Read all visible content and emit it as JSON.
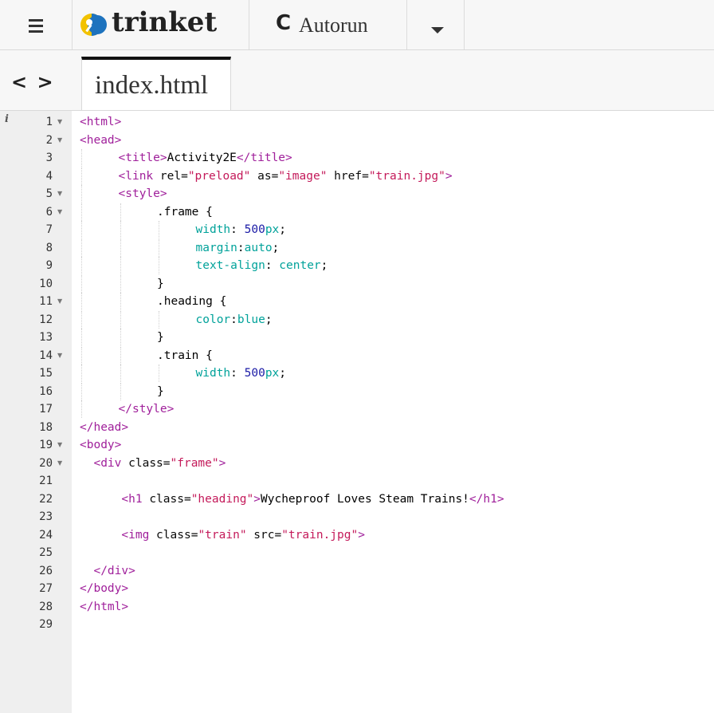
{
  "toolbar": {
    "menu_icon": "hamburger-icon",
    "logo_text": "trinket",
    "autorun_icon": "C",
    "autorun_label": "Autorun",
    "dropdown_icon": "caret-down-icon"
  },
  "tabs": {
    "code_toggle": "< >",
    "active_file": "index.html"
  },
  "editor": {
    "info_icon": "i",
    "lines": [
      {
        "n": "1",
        "fold": true,
        "indent": 0,
        "parts": [
          {
            "c": "t",
            "t": "<html>"
          }
        ]
      },
      {
        "n": "2",
        "fold": true,
        "indent": 0,
        "parts": [
          {
            "c": "t",
            "t": "<head>"
          }
        ]
      },
      {
        "n": "3",
        "fold": false,
        "indent": 1,
        "parts": [
          {
            "c": "t",
            "t": "<title>"
          },
          {
            "c": "x",
            "t": "Activity2E"
          },
          {
            "c": "t",
            "t": "</title>"
          }
        ]
      },
      {
        "n": "4",
        "fold": false,
        "indent": 1,
        "parts": [
          {
            "c": "t",
            "t": "<link "
          },
          {
            "c": "a",
            "t": "rel="
          },
          {
            "c": "s",
            "t": "\"preload\""
          },
          {
            "c": "a",
            "t": " as="
          },
          {
            "c": "s",
            "t": "\"image\""
          },
          {
            "c": "a",
            "t": " href="
          },
          {
            "c": "s",
            "t": "\"train.jpg\""
          },
          {
            "c": "t",
            "t": ">"
          }
        ]
      },
      {
        "n": "5",
        "fold": true,
        "indent": 1,
        "parts": [
          {
            "c": "t",
            "t": "<style>"
          }
        ]
      },
      {
        "n": "6",
        "fold": true,
        "indent": 2,
        "parts": [
          {
            "c": "x",
            "t": ".frame {"
          }
        ]
      },
      {
        "n": "7",
        "fold": false,
        "indent": 3,
        "parts": [
          {
            "c": "p",
            "t": "width"
          },
          {
            "c": "x",
            "t": ": "
          },
          {
            "c": "n",
            "t": "500"
          },
          {
            "c": "p",
            "t": "px"
          },
          {
            "c": "x",
            "t": ";"
          }
        ]
      },
      {
        "n": "8",
        "fold": false,
        "indent": 3,
        "parts": [
          {
            "c": "p",
            "t": "margin"
          },
          {
            "c": "x",
            "t": ":"
          },
          {
            "c": "p",
            "t": "auto"
          },
          {
            "c": "x",
            "t": ";"
          }
        ]
      },
      {
        "n": "9",
        "fold": false,
        "indent": 3,
        "parts": [
          {
            "c": "p",
            "t": "text-align"
          },
          {
            "c": "x",
            "t": ": "
          },
          {
            "c": "p",
            "t": "center"
          },
          {
            "c": "x",
            "t": ";"
          }
        ]
      },
      {
        "n": "10",
        "fold": false,
        "indent": 2,
        "parts": [
          {
            "c": "x",
            "t": "}"
          }
        ]
      },
      {
        "n": "11",
        "fold": true,
        "indent": 2,
        "parts": [
          {
            "c": "x",
            "t": ".heading {"
          }
        ]
      },
      {
        "n": "12",
        "fold": false,
        "indent": 3,
        "parts": [
          {
            "c": "p",
            "t": "color"
          },
          {
            "c": "x",
            "t": ":"
          },
          {
            "c": "p",
            "t": "blue"
          },
          {
            "c": "x",
            "t": ";"
          }
        ]
      },
      {
        "n": "13",
        "fold": false,
        "indent": 2,
        "parts": [
          {
            "c": "x",
            "t": "}"
          }
        ]
      },
      {
        "n": "14",
        "fold": true,
        "indent": 2,
        "parts": [
          {
            "c": "x",
            "t": ".train {"
          }
        ]
      },
      {
        "n": "15",
        "fold": false,
        "indent": 3,
        "parts": [
          {
            "c": "p",
            "t": "width"
          },
          {
            "c": "x",
            "t": ": "
          },
          {
            "c": "n",
            "t": "500"
          },
          {
            "c": "p",
            "t": "px"
          },
          {
            "c": "x",
            "t": ";"
          }
        ]
      },
      {
        "n": "16",
        "fold": false,
        "indent": 2,
        "parts": [
          {
            "c": "x",
            "t": "}"
          }
        ]
      },
      {
        "n": "17",
        "fold": false,
        "indent": 1,
        "parts": [
          {
            "c": "t",
            "t": "</style>"
          }
        ]
      },
      {
        "n": "18",
        "fold": false,
        "indent": 0,
        "parts": [
          {
            "c": "t",
            "t": "</head>"
          }
        ]
      },
      {
        "n": "19",
        "fold": true,
        "indent": 0,
        "parts": [
          {
            "c": "t",
            "t": "<body>"
          }
        ]
      },
      {
        "n": "20",
        "fold": true,
        "indent": 0,
        "parts": [
          {
            "c": "x",
            "t": "  "
          },
          {
            "c": "t",
            "t": "<div "
          },
          {
            "c": "a",
            "t": "class="
          },
          {
            "c": "s",
            "t": "\"frame\""
          },
          {
            "c": "t",
            "t": ">"
          }
        ]
      },
      {
        "n": "21",
        "fold": false,
        "indent": 0,
        "parts": []
      },
      {
        "n": "22",
        "fold": false,
        "indent": 0,
        "parts": [
          {
            "c": "x",
            "t": "      "
          },
          {
            "c": "t",
            "t": "<h1 "
          },
          {
            "c": "a",
            "t": "class="
          },
          {
            "c": "s",
            "t": "\"heading\""
          },
          {
            "c": "t",
            "t": ">"
          },
          {
            "c": "x",
            "t": "Wycheproof Loves Steam Trains!"
          },
          {
            "c": "t",
            "t": "</h1>"
          }
        ]
      },
      {
        "n": "23",
        "fold": false,
        "indent": 0,
        "parts": []
      },
      {
        "n": "24",
        "fold": false,
        "indent": 0,
        "parts": [
          {
            "c": "x",
            "t": "      "
          },
          {
            "c": "t",
            "t": "<img "
          },
          {
            "c": "a",
            "t": "class="
          },
          {
            "c": "s",
            "t": "\"train\""
          },
          {
            "c": "a",
            "t": " src="
          },
          {
            "c": "s",
            "t": "\"train.jpg\""
          },
          {
            "c": "t",
            "t": ">"
          }
        ]
      },
      {
        "n": "25",
        "fold": false,
        "indent": 0,
        "parts": []
      },
      {
        "n": "26",
        "fold": false,
        "indent": 0,
        "parts": [
          {
            "c": "x",
            "t": "  "
          },
          {
            "c": "t",
            "t": "</div>"
          }
        ]
      },
      {
        "n": "27",
        "fold": false,
        "indent": 0,
        "parts": [
          {
            "c": "t",
            "t": "</body>"
          }
        ]
      },
      {
        "n": "28",
        "fold": false,
        "indent": 0,
        "parts": [
          {
            "c": "t",
            "t": "</html>"
          }
        ]
      },
      {
        "n": "29",
        "fold": false,
        "indent": 0,
        "parts": []
      }
    ]
  },
  "colors": {
    "tag": "#a0209b",
    "string": "#c41a5a",
    "number": "#1a1aa6",
    "property": "#00a29a",
    "gutter_bg": "#efefef"
  }
}
